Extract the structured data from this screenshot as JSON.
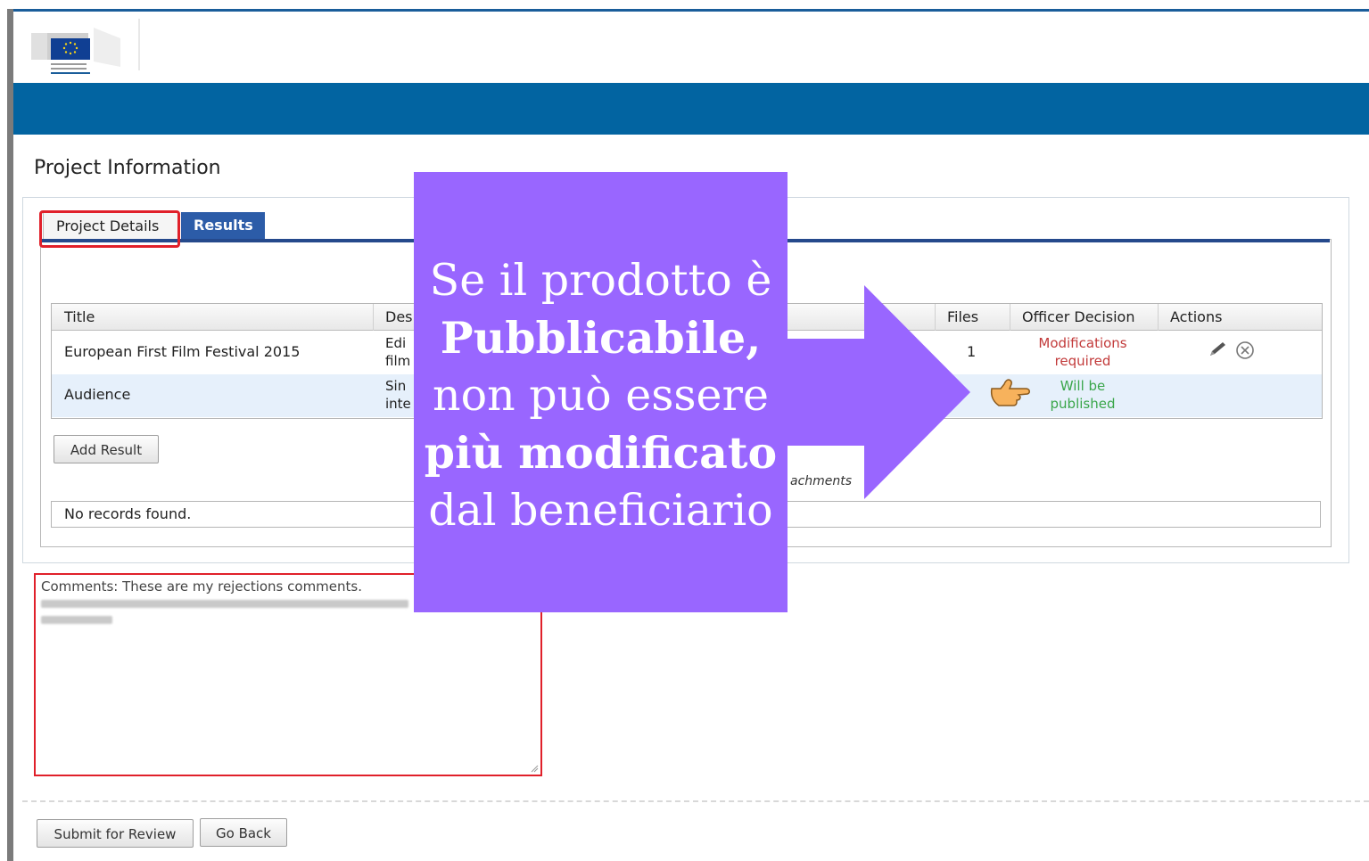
{
  "page": {
    "title": "Project Information"
  },
  "tabs": [
    {
      "label": "Project Details",
      "active": false
    },
    {
      "label": "Results",
      "active": true
    }
  ],
  "results_table": {
    "columns": [
      "Title",
      "Des",
      "Files",
      "Officer Decision",
      "Actions"
    ],
    "rows": [
      {
        "title": "European First Film Festival 2015",
        "desc_line1": "Edi",
        "desc_line2": "film",
        "files": "1",
        "decision_line1": "Modifications",
        "decision_line2": "required"
      },
      {
        "title": "Audience",
        "desc_line1": "Sin",
        "desc_line2": "inte",
        "files": "",
        "decision_line1": "Will be",
        "decision_line2": "published"
      }
    ]
  },
  "buttons": {
    "add_result": "Add Result",
    "submit_review": "Submit for Review",
    "go_back": "Go Back"
  },
  "attachments_label": "achments",
  "no_records": "No records found.",
  "comments": {
    "text": "Comments: These are my rejections comments."
  },
  "overlay": {
    "line1": "Se il prodotto è",
    "line2": "Pubblicabile,",
    "line3": "non può essere",
    "line4": "più modificato",
    "line5": "dal beneficiario"
  },
  "colors": {
    "brand_blue": "#0264a1",
    "tab_blue": "#2c5ca8",
    "overlay_purple": "#9966ff",
    "highlight_red": "#e0202a",
    "status_red": "#c23a3a",
    "status_green": "#3aa64a"
  },
  "icons": [
    "eu-flag-logo",
    "pencil-icon",
    "delete-circle-icon",
    "pointing-hand-icon",
    "right-arrow-icon",
    "resize-handle-icon"
  ]
}
